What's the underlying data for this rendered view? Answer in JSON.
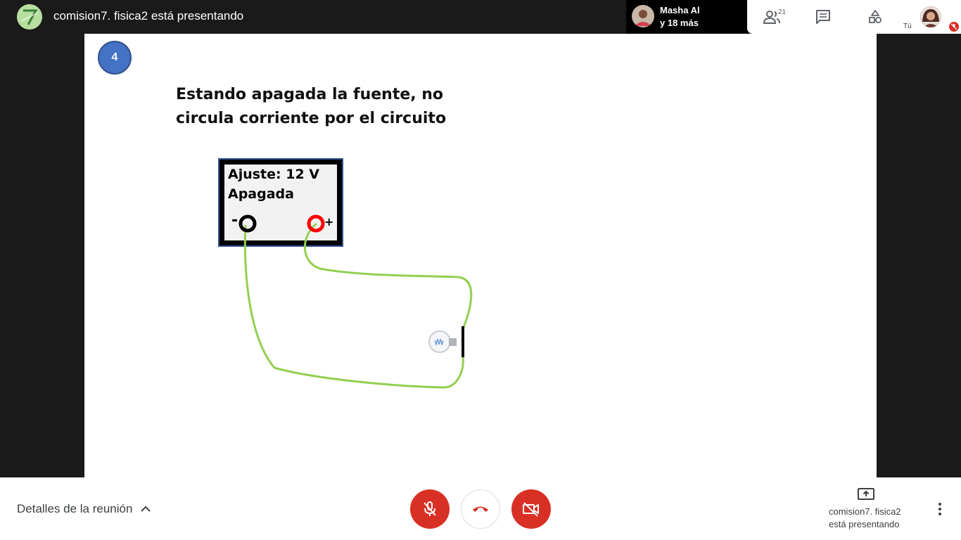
{
  "topbar": {
    "presenter_title": "comision7. fisica2 está presentando",
    "others_name": "Masha Al",
    "others_more": "y 18 más",
    "people_count": "21",
    "self_label": "Tú"
  },
  "slide": {
    "number": "4",
    "heading_line1": "Estando apagada la fuente, no",
    "heading_line2": "circula corriente por el circuito",
    "supply_setting": "Ajuste: 12 V",
    "supply_state": "Apagada",
    "terminal_negative": "-",
    "terminal_positive": "+"
  },
  "bottombar": {
    "meeting_details": "Detalles de la reunión",
    "presenting_line1": "comision7. fisica2",
    "presenting_line2": "está presentando"
  },
  "colors": {
    "accent_red": "#d93025",
    "wire_green": "#92d050",
    "slide_number_blue": "#4472c4"
  }
}
